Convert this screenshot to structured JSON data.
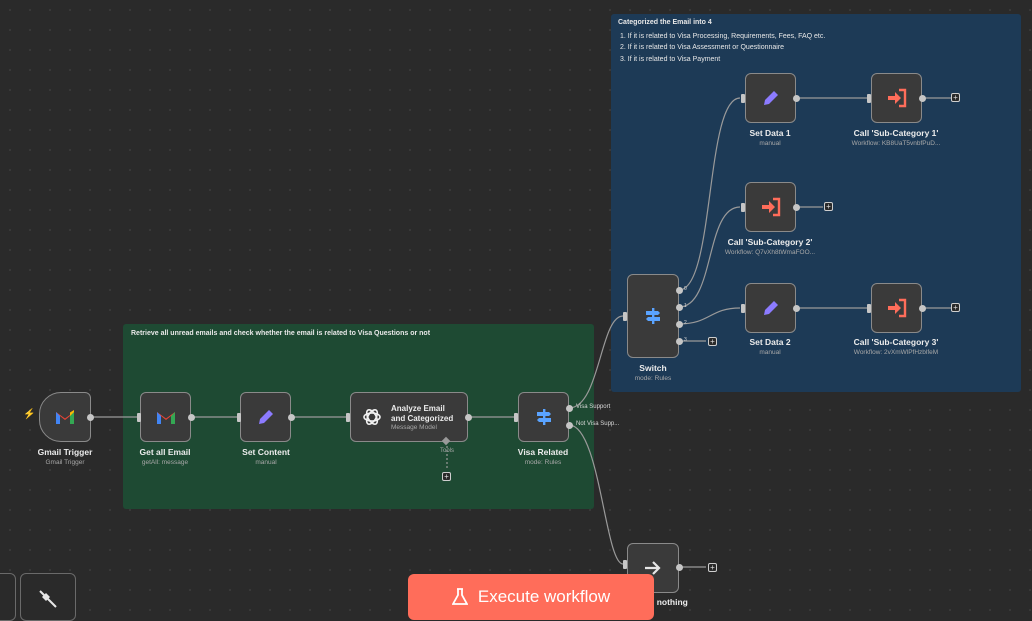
{
  "sticky_notes": {
    "filter": {
      "title": "Retrieve all unread emails and check whether the email is related to Visa Questions or not"
    },
    "categorize": {
      "title": "Categorized the Email into 4",
      "lines": [
        "1. If it is related to Visa Processing, Requirements, Fees, FAQ etc.",
        "2. If it is related to Visa Assessment or Questionnaire",
        "3. If it is related to Visa Payment"
      ]
    }
  },
  "nodes": {
    "gmail_trigger": {
      "label": "Gmail Trigger",
      "sub": "Gmail Trigger",
      "icon": "gmail-icon"
    },
    "get_all_email": {
      "label": "Get all Email",
      "sub": "getAll: message",
      "icon": "gmail-icon"
    },
    "set_content": {
      "label": "Set Content",
      "sub": "manual",
      "icon": "pencil-icon"
    },
    "analyze": {
      "label_line1": "Analyze Email",
      "label_line2": "and Categorized",
      "sub": "Message Model",
      "tools_label": "Tools",
      "icon": "openai-icon"
    },
    "visa_related": {
      "label": "Visa Related",
      "sub": "mode: Rules",
      "icon": "signpost-icon",
      "out1": "Visa Support",
      "out2": "Not Visa Supp..."
    },
    "switch": {
      "label": "Switch",
      "sub": "mode: Rules",
      "icon": "signpost-icon",
      "ports": [
        "0",
        "1",
        "2",
        "3"
      ]
    },
    "set_data_1": {
      "label": "Set Data 1",
      "sub": "manual",
      "icon": "pencil-icon"
    },
    "call_sub_1": {
      "label": "Call 'Sub-Category 1'",
      "sub": "Workflow: KB8UaT5vnbfPuD...",
      "icon": "call-workflow-icon"
    },
    "call_sub_2": {
      "label": "Call 'Sub-Category 2'",
      "sub": "Workflow: Q7vXh8tWmaFOO...",
      "icon": "call-workflow-icon"
    },
    "set_data_2": {
      "label": "Set Data 2",
      "sub": "manual",
      "icon": "pencil-icon"
    },
    "call_sub_3": {
      "label": "Call 'Sub-Category 3'",
      "sub": "Workflow: 2vXmWlPfHzblfeM",
      "icon": "call-workflow-icon"
    },
    "do_nothing": {
      "label": "..., do nothing",
      "icon": "arrow-right-icon"
    }
  },
  "toolbar": {
    "execute_label": "Execute workflow"
  },
  "colors": {
    "accent": "#ff6d5a",
    "green_note": "#1e4a33",
    "blue_note": "#1d3a56",
    "node_bg": "#3a3a3a",
    "pencil": "#8c7bff",
    "signpost": "#5aa3ff"
  }
}
